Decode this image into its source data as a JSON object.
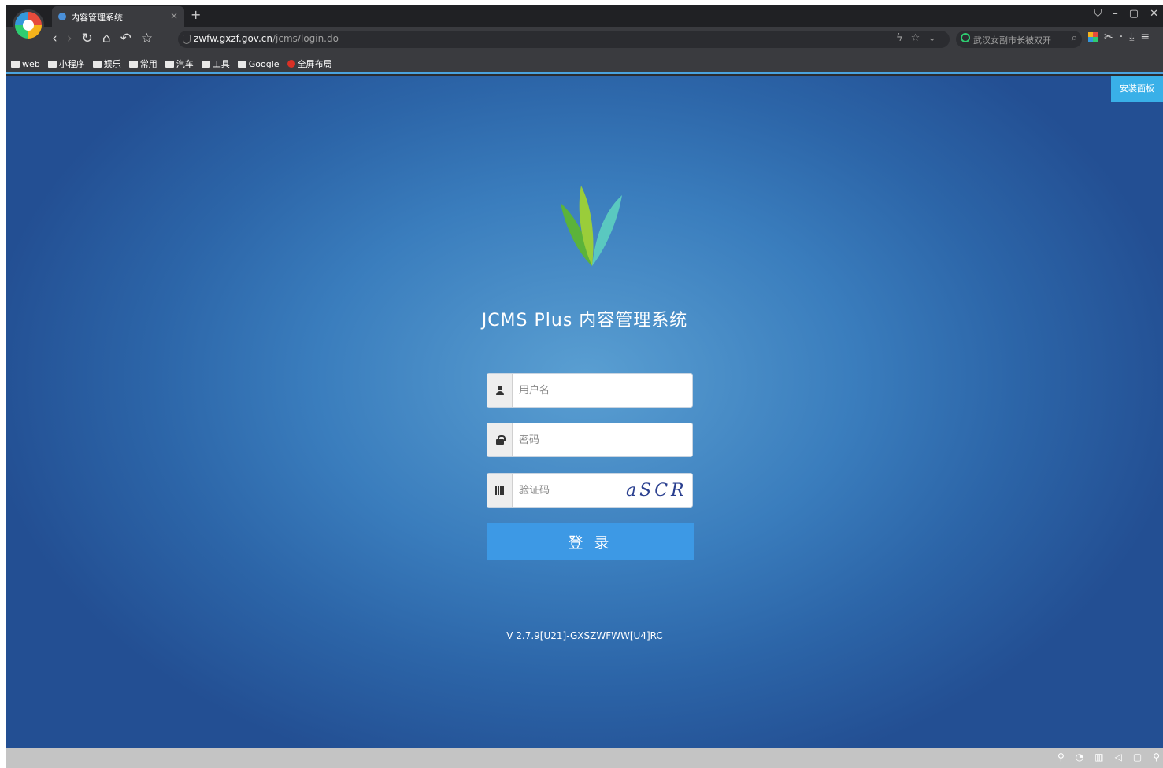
{
  "browser": {
    "tab_title": "内容管理系统",
    "tab_close": "×",
    "new_tab": "+",
    "window_controls": [
      "⛉",
      "–",
      "▢",
      "✕"
    ],
    "nav_icons": [
      "back-icon",
      "forward-icon",
      "reload-icon",
      "home-icon",
      "undo-icon",
      "star-icon"
    ],
    "url_host": "zwfw.gxzf.gov.cn",
    "url_path": "/jcms/login.do",
    "search_text": "武汉女副市长被双开",
    "bookmarks": [
      "web",
      "小程序",
      "娱乐",
      "常用",
      "汽车",
      "工具",
      "Google",
      "全屏布局"
    ]
  },
  "page": {
    "install_panel": "安装面板",
    "app_title": "JCMS Plus 内容管理系统",
    "username_placeholder": "用户名",
    "password_placeholder": "密码",
    "captcha_placeholder": "验证码",
    "captcha_text": "aSCR",
    "login_button": "登 录",
    "version": "V 2.7.9[U21]-GXSZWFWW[U4]RC"
  },
  "colors": {
    "accent": "#3d99e5",
    "install": "#39b0e8",
    "leaf_green": "#6cc04a",
    "leaf_teal": "#5ac8c0"
  }
}
